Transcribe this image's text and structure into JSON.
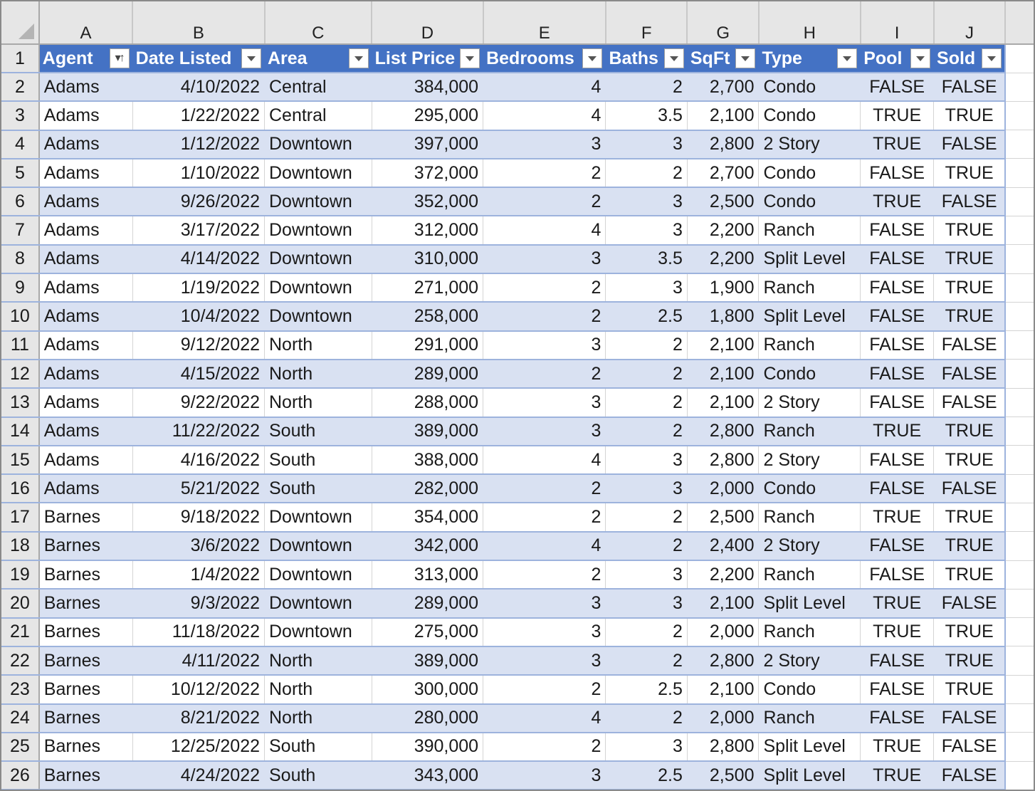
{
  "sheet": {
    "column_letters": [
      "A",
      "B",
      "C",
      "D",
      "E",
      "F",
      "G",
      "H",
      "I",
      "J"
    ],
    "header_row_number": "1",
    "headers": [
      {
        "label": "Agent",
        "control": "sort-ascending-filter"
      },
      {
        "label": "Date Listed",
        "control": "filter"
      },
      {
        "label": "Area",
        "control": "filter"
      },
      {
        "label": "List Price",
        "control": "filter"
      },
      {
        "label": "Bedrooms",
        "control": "filter"
      },
      {
        "label": "Baths",
        "control": "filter"
      },
      {
        "label": "SqFt",
        "control": "filter"
      },
      {
        "label": "Type",
        "control": "filter"
      },
      {
        "label": "Pool",
        "control": "filter"
      },
      {
        "label": "Sold",
        "control": "filter"
      }
    ],
    "icons": {
      "sort_glyph": "▾↑",
      "corner": "select-all-triangle"
    },
    "colors": {
      "header_fill": "#4472c4",
      "band_fill": "#d9e1f2",
      "band_border": "#9db3dd"
    },
    "rows": [
      {
        "n": "2",
        "cells": [
          "Adams",
          "4/10/2022",
          "Central",
          "384,000",
          "4",
          "2",
          "2,700",
          "Condo",
          "FALSE",
          "FALSE"
        ]
      },
      {
        "n": "3",
        "cells": [
          "Adams",
          "1/22/2022",
          "Central",
          "295,000",
          "4",
          "3.5",
          "2,100",
          "Condo",
          "TRUE",
          "TRUE"
        ]
      },
      {
        "n": "4",
        "cells": [
          "Adams",
          "1/12/2022",
          "Downtown",
          "397,000",
          "3",
          "3",
          "2,800",
          "2 Story",
          "TRUE",
          "FALSE"
        ]
      },
      {
        "n": "5",
        "cells": [
          "Adams",
          "1/10/2022",
          "Downtown",
          "372,000",
          "2",
          "2",
          "2,700",
          "Condo",
          "FALSE",
          "TRUE"
        ]
      },
      {
        "n": "6",
        "cells": [
          "Adams",
          "9/26/2022",
          "Downtown",
          "352,000",
          "2",
          "3",
          "2,500",
          "Condo",
          "TRUE",
          "FALSE"
        ]
      },
      {
        "n": "7",
        "cells": [
          "Adams",
          "3/17/2022",
          "Downtown",
          "312,000",
          "4",
          "3",
          "2,200",
          "Ranch",
          "FALSE",
          "TRUE"
        ]
      },
      {
        "n": "8",
        "cells": [
          "Adams",
          "4/14/2022",
          "Downtown",
          "310,000",
          "3",
          "3.5",
          "2,200",
          "Split Level",
          "FALSE",
          "TRUE"
        ]
      },
      {
        "n": "9",
        "cells": [
          "Adams",
          "1/19/2022",
          "Downtown",
          "271,000",
          "2",
          "3",
          "1,900",
          "Ranch",
          "FALSE",
          "TRUE"
        ]
      },
      {
        "n": "10",
        "cells": [
          "Adams",
          "10/4/2022",
          "Downtown",
          "258,000",
          "2",
          "2.5",
          "1,800",
          "Split Level",
          "FALSE",
          "TRUE"
        ]
      },
      {
        "n": "11",
        "cells": [
          "Adams",
          "9/12/2022",
          "North",
          "291,000",
          "3",
          "2",
          "2,100",
          "Ranch",
          "FALSE",
          "FALSE"
        ]
      },
      {
        "n": "12",
        "cells": [
          "Adams",
          "4/15/2022",
          "North",
          "289,000",
          "2",
          "2",
          "2,100",
          "Condo",
          "FALSE",
          "FALSE"
        ]
      },
      {
        "n": "13",
        "cells": [
          "Adams",
          "9/22/2022",
          "North",
          "288,000",
          "3",
          "2",
          "2,100",
          "2 Story",
          "FALSE",
          "FALSE"
        ]
      },
      {
        "n": "14",
        "cells": [
          "Adams",
          "11/22/2022",
          "South",
          "389,000",
          "3",
          "2",
          "2,800",
          "Ranch",
          "TRUE",
          "TRUE"
        ]
      },
      {
        "n": "15",
        "cells": [
          "Adams",
          "4/16/2022",
          "South",
          "388,000",
          "4",
          "3",
          "2,800",
          "2 Story",
          "FALSE",
          "TRUE"
        ]
      },
      {
        "n": "16",
        "cells": [
          "Adams",
          "5/21/2022",
          "South",
          "282,000",
          "2",
          "3",
          "2,000",
          "Condo",
          "FALSE",
          "FALSE"
        ]
      },
      {
        "n": "17",
        "cells": [
          "Barnes",
          "9/18/2022",
          "Downtown",
          "354,000",
          "2",
          "2",
          "2,500",
          "Ranch",
          "TRUE",
          "TRUE"
        ]
      },
      {
        "n": "18",
        "cells": [
          "Barnes",
          "3/6/2022",
          "Downtown",
          "342,000",
          "4",
          "2",
          "2,400",
          "2 Story",
          "FALSE",
          "TRUE"
        ]
      },
      {
        "n": "19",
        "cells": [
          "Barnes",
          "1/4/2022",
          "Downtown",
          "313,000",
          "2",
          "3",
          "2,200",
          "Ranch",
          "FALSE",
          "TRUE"
        ]
      },
      {
        "n": "20",
        "cells": [
          "Barnes",
          "9/3/2022",
          "Downtown",
          "289,000",
          "3",
          "3",
          "2,100",
          "Split Level",
          "TRUE",
          "FALSE"
        ]
      },
      {
        "n": "21",
        "cells": [
          "Barnes",
          "11/18/2022",
          "Downtown",
          "275,000",
          "3",
          "2",
          "2,000",
          "Ranch",
          "TRUE",
          "TRUE"
        ]
      },
      {
        "n": "22",
        "cells": [
          "Barnes",
          "4/11/2022",
          "North",
          "389,000",
          "3",
          "2",
          "2,800",
          "2 Story",
          "FALSE",
          "TRUE"
        ]
      },
      {
        "n": "23",
        "cells": [
          "Barnes",
          "10/12/2022",
          "North",
          "300,000",
          "2",
          "2.5",
          "2,100",
          "Condo",
          "FALSE",
          "TRUE"
        ]
      },
      {
        "n": "24",
        "cells": [
          "Barnes",
          "8/21/2022",
          "North",
          "280,000",
          "4",
          "2",
          "2,000",
          "Ranch",
          "FALSE",
          "FALSE"
        ]
      },
      {
        "n": "25",
        "cells": [
          "Barnes",
          "12/25/2022",
          "South",
          "390,000",
          "2",
          "3",
          "2,800",
          "Split Level",
          "TRUE",
          "FALSE"
        ]
      },
      {
        "n": "26",
        "cells": [
          "Barnes",
          "4/24/2022",
          "South",
          "343,000",
          "3",
          "2.5",
          "2,500",
          "Split Level",
          "TRUE",
          "FALSE"
        ]
      }
    ]
  }
}
